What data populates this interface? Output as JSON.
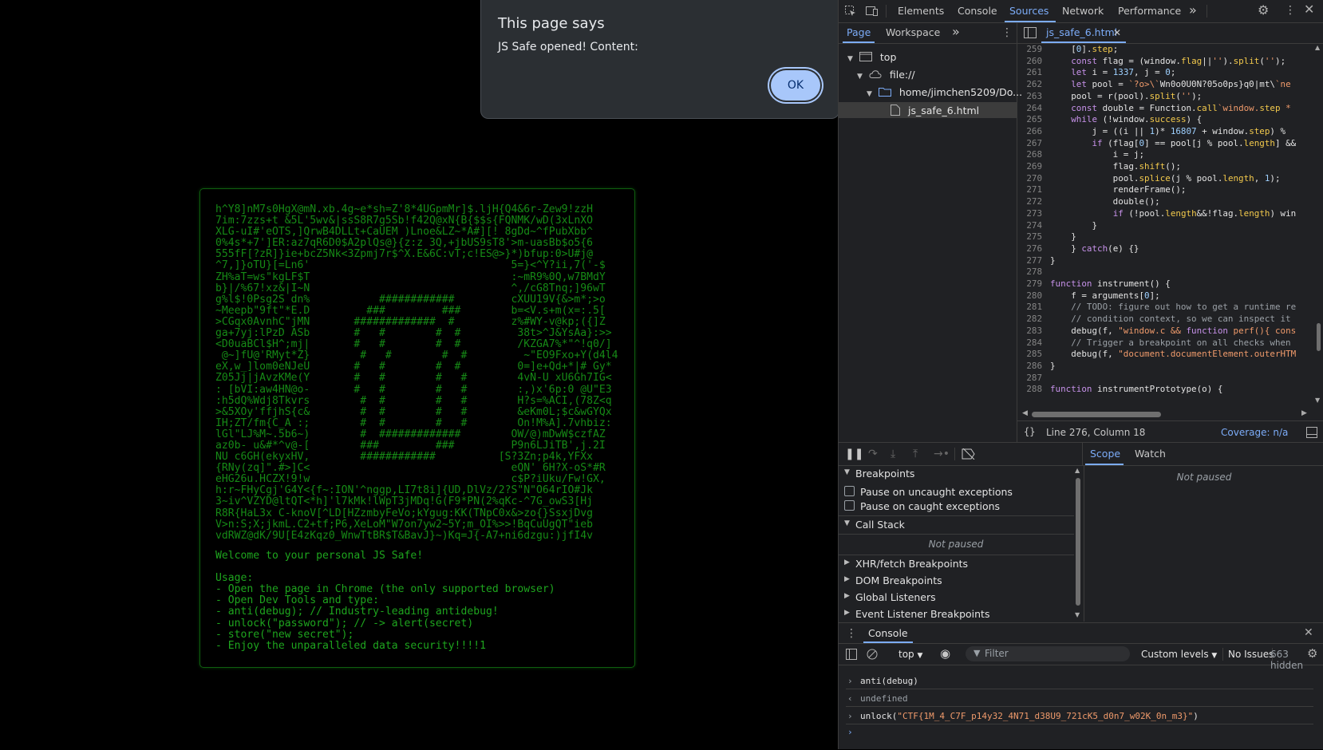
{
  "page": {
    "ascii_art": "h^Y8]nM7s0HgX@mN.xb.4g~e*sh=Z'8*4UGpmMr]$.ljH{Q4&6r-Zew9!zzH\n7im:7zzs+t &5L'5wv&|ssS8R7g5Sb!f42Q@xN{B{$$s{FQNMK/wD(3xLnXO\nXLG-uI#'eOTS,]QrwB4DLLt+CaUEM )Lnoe&LZ~*A#][! 8gDd~^fPubXbb^\n0%4s*+7']ER:az7qR6D0$A2plQs@}{z:z 3Q,+jbUS9sT8'>m-uasBb$o5{6\n555fF[?zR]}ie+bcZ5Nk<3Zpmj7r$^X.E&6C:vT;c!ES@>}*)bfup:0>U#j@\n^7,]}oTU}[=Ln6'                                5=}<^Y?ii,7('-$\nZH%aT=ws\"kgLF$T                                :~mR9%0Q,w7BMdY\nb}|/%67!xz&|I~N                                ^,/cG8Tnq;]96wT\ng%l$!0Psg2S dn%           ############         cXUU19V{&>m*;>o\n~Meepb\"9ft\"*E.D         ###         ###        b=<V.s+m(x=:.5[\n>CGqx0AvnhC\"jMN       #############  #         z%#WY-v@kp;({]Z\nga+7yj:lPzD ASb       #   #        #  #         38t>^J&YsAa}:>>\n<D0uaBCl$H^;mj|       #   #        #  #         /KZGA7%*\"^!q0/]\n @~]fU@'RMyt*Z}        #   #        #  #         ~\"EO9Fxo+Y(d4l4\neX,w_]lom0eNJeU       #   #        #  #         0=]e+Qd+*|# Gy*\nZ05Jj|jAvzKMe(Y       #   #        #   #        4vN-U xU6Gh7IG<\n: [bVI:aw4HN@o-       #   #        #   #        :,)x'6p:0 @U\"E3\n:h5dQ%Wdj8Tkvrs        #  #        #   #        H?s=%ACI,(78Z<q\n>&5XOy'ffjhS{c&        #  #        #   #        &eKm0L;$c&wGYQx\nIH;ZT/fm{C_A :;        #  #        #   #        On!M%A].7vhbiz:\nlGl\"LJ%M~.5b6~)        #  #############        OW/@)mDwW$czfAZ\naz0b- u&#*^v@-[        ###         ###         P9n6LJiTB',j.2I\nNU c6GH(ekyxHV,        ############          [S?3Zn;p4k,YFXx\n{RNy(zq]\".#>]C<                                eQN' 6H?X-oS*#R\neHG26u.HCZX!9!w                                c$P?iUku/Fw!GX,\nh:r~FHyCgj'G4Y<{f~:ION'^nggp,LI7t8i]{UD,DlVz/2?S\"N\"O64rIO#Jk\n3~iv^VZYD@ltQT<*h]'l7kMk!lWpT3jMDq!G(F9*PN(2%qKc-^7G_owS3[Hj\nR8R{HaL3x C-knoV[^LD[HZzmbyFeVo;kYgug:KK(TNpC0x&>zo{}SsxjDvg\nV>n:S;X;jkmL.C2+tf;P6,XeLoM\"W7on7yw2~5Y;m_OI%>>!BqCuUgQT\"ieb\nvdRWZ@dK/9U[E4zKqz0_WnwTtBR$T&BavJ}~)Kq=J{-A7+ni6dzgu:)jfI4v",
    "welcome": "Welcome to your personal JS Safe!\n\nUsage:\n- Open the page in Chrome (the only supported browser)\n- Open Dev Tools and type:\n- anti(debug); // Industry-leading antidebug!\n- unlock(\"password\"); // -> alert(secret)\n- store(\"new secret\");\n- Enjoy the unparalleled data security!!!!1"
  },
  "alert": {
    "title": "This page says",
    "message": "JS Safe opened! Content:",
    "ok_label": "OK"
  },
  "devtools": {
    "tabs": [
      "Elements",
      "Console",
      "Sources",
      "Network",
      "Performance"
    ],
    "active_tab": "Sources",
    "more_tabs": "»",
    "navigator": {
      "tabs": [
        "Page",
        "Workspace"
      ],
      "active_tab": "Page",
      "more": "»",
      "tree": [
        {
          "label": "top",
          "icon": "frame-icon",
          "level": 0
        },
        {
          "label": "file://",
          "icon": "cloud-icon",
          "level": 1
        },
        {
          "label": "home/jimchen5209/Do...",
          "icon": "folder-icon",
          "level": 2
        },
        {
          "label": "js_safe_6.html",
          "icon": "file-icon",
          "level": 3
        }
      ]
    },
    "editor": {
      "file_tab": "js_safe_6.html",
      "lines": [
        {
          "n": "259",
          "code": "    [0].step;"
        },
        {
          "n": "260",
          "code": "    const flag = (window.flag||'').split('');"
        },
        {
          "n": "261",
          "code": "    let i = 1337, j = 0;"
        },
        {
          "n": "262",
          "code": "    let pool = `?o>\\`Wn0o0U0N?05o0ps}q0|mt\\`ne"
        },
        {
          "n": "263",
          "code": "    pool = r(pool).split('');"
        },
        {
          "n": "264",
          "code": "    const double = Function.call`window.step *"
        },
        {
          "n": "265",
          "code": "    while (!window.success) {"
        },
        {
          "n": "266",
          "code": "        j = ((i || 1)* 16807 + window.step) %"
        },
        {
          "n": "267",
          "code": "        if (flag[0] == pool[j % pool.length] &&"
        },
        {
          "n": "268",
          "code": "            i = j;"
        },
        {
          "n": "269",
          "code": "            flag.shift();"
        },
        {
          "n": "270",
          "code": "            pool.splice(j % pool.length, 1);"
        },
        {
          "n": "271",
          "code": "            renderFrame();"
        },
        {
          "n": "272",
          "code": "            double();"
        },
        {
          "n": "273",
          "code": "            if (!pool.length&&!flag.length) win"
        },
        {
          "n": "274",
          "code": "        }"
        },
        {
          "n": "275",
          "code": "    }"
        },
        {
          "n": "276",
          "code": "    } catch(e) {}"
        },
        {
          "n": "277",
          "code": "}"
        },
        {
          "n": "278",
          "code": ""
        },
        {
          "n": "279",
          "code": "function instrument() {"
        },
        {
          "n": "280",
          "code": "    f = arguments[0];"
        },
        {
          "n": "281",
          "code": "    // TODO: figure out how to get a runtime re"
        },
        {
          "n": "282",
          "code": "    // condition context, so we can inspect it"
        },
        {
          "n": "283",
          "code": "    debug(f, \"window.c && function perf(){ cons"
        },
        {
          "n": "284",
          "code": "    // Trigger a breakpoint on all checks when"
        },
        {
          "n": "285",
          "code": "    debug(f, \"document.documentElement.outerHTM"
        },
        {
          "n": "286",
          "code": "}"
        },
        {
          "n": "287",
          "code": ""
        },
        {
          "n": "288",
          "code": "function instrumentPrototype(o) {"
        }
      ],
      "status_position": "Line 276, Column 18",
      "coverage": "Coverage: n/a"
    },
    "breakpoints": {
      "header": "Breakpoints",
      "pause_uncaught": "Pause on uncaught exceptions",
      "pause_caught": "Pause on caught exceptions",
      "call_stack": "Call Stack",
      "not_paused": "Not paused",
      "collapsed_sections": [
        "XHR/fetch Breakpoints",
        "DOM Breakpoints",
        "Global Listeners",
        "Event Listener Breakpoints"
      ]
    },
    "scope": {
      "tabs": [
        "Scope",
        "Watch"
      ],
      "active_tab": "Scope",
      "not_paused": "Not paused"
    },
    "console": {
      "title": "Console",
      "context": "top",
      "filter_placeholder": "Filter",
      "levels": "Custom levels",
      "issues": "No Issues",
      "hidden": "663 hidden",
      "entries": [
        {
          "type": "input",
          "prefix": "›",
          "text": "anti(debug)"
        },
        {
          "type": "result",
          "prefix": "‹",
          "text": "undefined"
        },
        {
          "type": "input",
          "prefix": "›",
          "text_fn": "unlock(",
          "text_arg": "\"CTF{1M_4_C7F_p14y32_4N71_d38U9_721cK5_d0n7_w02K_0n_m3}\"",
          "text_end": ")"
        }
      ],
      "prompt": "›"
    },
    "colors": {
      "accent": "#7cacf8",
      "background": "#202124",
      "safe_green": "#168a16"
    }
  }
}
